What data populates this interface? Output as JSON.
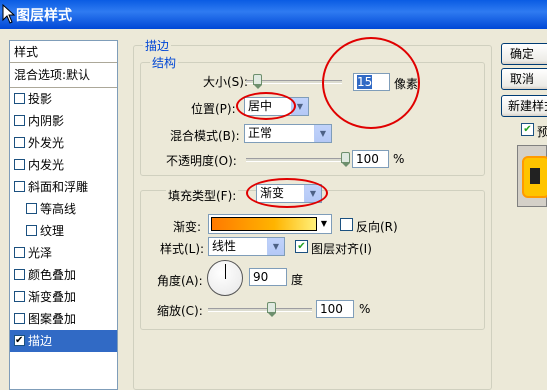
{
  "window": {
    "title": "图层样式"
  },
  "sidebar": {
    "header": "样式",
    "blend_options": "混合选项:默认",
    "items": [
      {
        "label": "投影",
        "checked": false
      },
      {
        "label": "内阴影",
        "checked": false
      },
      {
        "label": "外发光",
        "checked": false
      },
      {
        "label": "内发光",
        "checked": false
      },
      {
        "label": "斜面和浮雕",
        "checked": false
      },
      {
        "label": "等高线",
        "checked": false
      },
      {
        "label": "纹理",
        "checked": false
      },
      {
        "label": "光泽",
        "checked": false
      },
      {
        "label": "颜色叠加",
        "checked": false
      },
      {
        "label": "渐变叠加",
        "checked": false
      },
      {
        "label": "图案叠加",
        "checked": false
      },
      {
        "label": "描边",
        "checked": true
      }
    ]
  },
  "stroke": {
    "title": "描边",
    "structure": {
      "title": "结构",
      "size_label": "大小(S):",
      "size_value": "15",
      "size_unit": "像素",
      "position_label": "位置(P):",
      "position_value": "居中",
      "blend_label": "混合模式(B):",
      "blend_value": "正常",
      "opacity_label": "不透明度(O):",
      "opacity_value": "100",
      "opacity_unit": "%"
    },
    "fill": {
      "type_label": "填充类型(F):",
      "type_value": "渐变",
      "gradient_label": "渐变:",
      "reverse_label": "反向(R)",
      "reverse_checked": false,
      "style_label": "样式(L):",
      "style_value": "线性",
      "align_label": "图层对齐(I)",
      "align_checked": true,
      "angle_label": "角度(A):",
      "angle_value": "90",
      "angle_unit": "度",
      "scale_label": "缩放(C):",
      "scale_value": "100",
      "scale_unit": "%"
    }
  },
  "right_panel": {
    "btn1": "确定",
    "btn2": "取消",
    "new_style": "新建样式",
    "preview_label": "预览",
    "preview_checked": true
  },
  "colors": {
    "title_bar": "#0a5ce3",
    "group_label": "#0046d5",
    "selection": "#316ac5",
    "annotation": "#e00000"
  }
}
